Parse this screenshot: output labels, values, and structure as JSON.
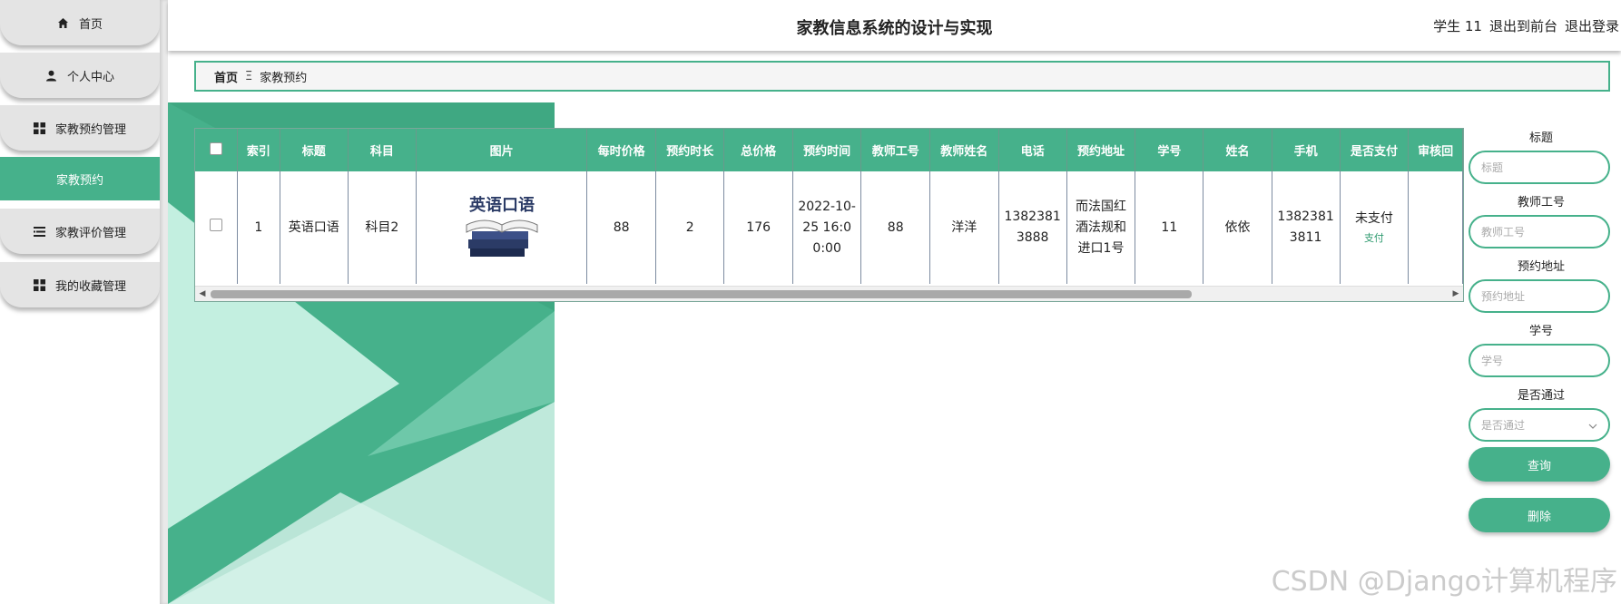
{
  "header": {
    "title": "家教信息系统的设计与实现",
    "user": "学生 11",
    "to_front": "退出到前台",
    "logout": "退出登录"
  },
  "sidebar": {
    "items": [
      {
        "label": "首页",
        "icon": "home-icon"
      },
      {
        "label": "个人中心",
        "icon": "user-icon"
      },
      {
        "label": "家教预约管理",
        "icon": "grid-icon"
      },
      {
        "label": "家教预约",
        "icon": ""
      },
      {
        "label": "家教评价管理",
        "icon": "list-icon"
      },
      {
        "label": "我的收藏管理",
        "icon": "grid-icon"
      }
    ]
  },
  "breadcrumb": {
    "home": "首页",
    "separator": "Ξ",
    "current": "家教预约"
  },
  "table": {
    "headers": [
      "索引",
      "标题",
      "科目",
      "图片",
      "每时价格",
      "预约时长",
      "总价格",
      "预约时间",
      "教师工号",
      "教师姓名",
      "电话",
      "预约地址",
      "学号",
      "姓名",
      "手机",
      "是否支付",
      "审核回"
    ],
    "row": {
      "index": "1",
      "title": "英语口语",
      "subject": "科目2",
      "image_text": "英语口语",
      "price_per_hour": "88",
      "duration": "2",
      "total": "176",
      "time": "2022-10-25 16:00:00",
      "teacher_no": "88",
      "teacher_name": "洋洋",
      "phone": "13823813888",
      "address": "而法国红酒法规和进口1号",
      "student_no": "11",
      "name": "依依",
      "mobile": "13823813811",
      "paid": "未支付",
      "pay_link": "支付",
      "review": ""
    }
  },
  "search": {
    "title_label": "标题",
    "title_placeholder": "标题",
    "teacher_no_label": "教师工号",
    "teacher_no_placeholder": "教师工号",
    "address_label": "预约地址",
    "address_placeholder": "预约地址",
    "student_no_label": "学号",
    "student_no_placeholder": "学号",
    "pass_label": "是否通过",
    "pass_placeholder": "是否通过",
    "query_button": "查询",
    "delete_button": "删除"
  },
  "watermark": "CSDN @Django计算机程序",
  "colors": {
    "accent": "#46b18b",
    "sidebar_item": "#e4e4e4",
    "mint": "#c3efe0"
  }
}
